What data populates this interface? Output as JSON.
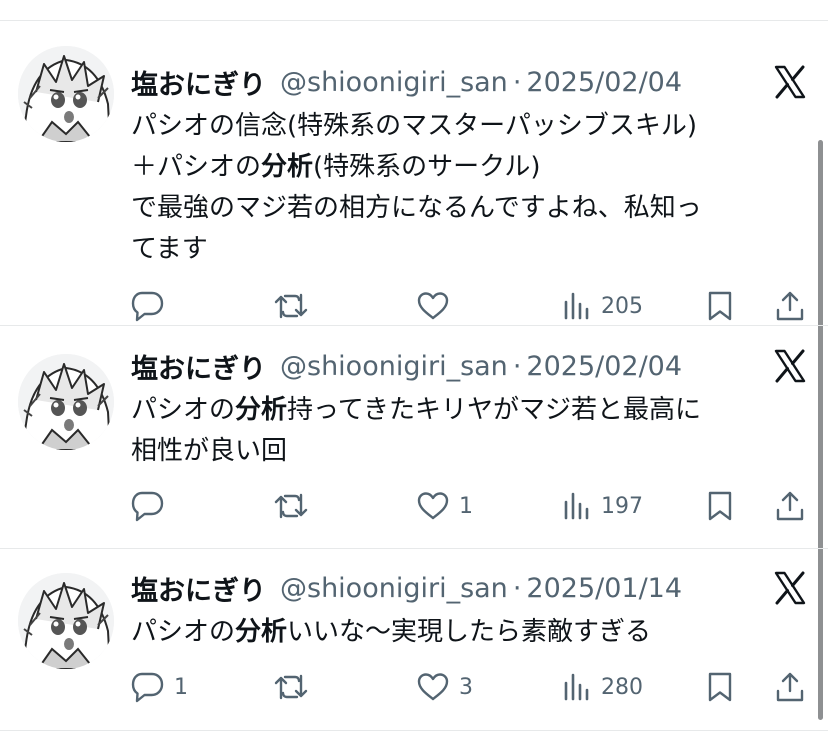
{
  "tweets": [
    {
      "display_name": "塩おにぎり",
      "handle": "@shioonigiri_san",
      "separator": "·",
      "date": "2025/02/04",
      "lines": [
        [
          {
            "text": "パシオの信念(特殊系のマスターパッシブスキル)",
            "bold": false
          }
        ],
        [
          {
            "text": "＋パシオの",
            "bold": false
          },
          {
            "text": "分析",
            "bold": true
          },
          {
            "text": "(特殊系のサークル)",
            "bold": false
          }
        ],
        [
          {
            "text": "で最強のマジ若の相方になるんですよね、私知っ",
            "bold": false
          }
        ],
        [
          {
            "text": "てます",
            "bold": false
          }
        ]
      ],
      "replies": "",
      "reposts": "",
      "likes": "",
      "views": "205"
    },
    {
      "display_name": "塩おにぎり",
      "handle": "@shioonigiri_san",
      "separator": "·",
      "date": "2025/02/04",
      "lines": [
        [
          {
            "text": "パシオの",
            "bold": false
          },
          {
            "text": "分析",
            "bold": true
          },
          {
            "text": "持ってきたキリヤがマジ若と最高に",
            "bold": false
          }
        ],
        [
          {
            "text": "相性が良い回",
            "bold": false
          }
        ]
      ],
      "replies": "",
      "reposts": "",
      "likes": "1",
      "views": "197"
    },
    {
      "display_name": "塩おにぎり",
      "handle": "@shioonigiri_san",
      "separator": "·",
      "date": "2025/01/14",
      "lines": [
        [
          {
            "text": "パシオの",
            "bold": false
          },
          {
            "text": "分析",
            "bold": true
          },
          {
            "text": "いいな〜実現したら素敵すぎる",
            "bold": false
          }
        ]
      ],
      "replies": "1",
      "reposts": "",
      "likes": "3",
      "views": "280"
    }
  ],
  "icons": {
    "avatar": "anime-character-avatar",
    "logo": "x-logo-icon",
    "reply": "reply-icon",
    "repost": "repost-icon",
    "like": "heart-icon",
    "views": "views-icon",
    "bookmark": "bookmark-icon",
    "share": "share-icon"
  },
  "colors": {
    "text": "#0f1419",
    "secondary": "#536471",
    "divider": "#e7e9ea"
  }
}
